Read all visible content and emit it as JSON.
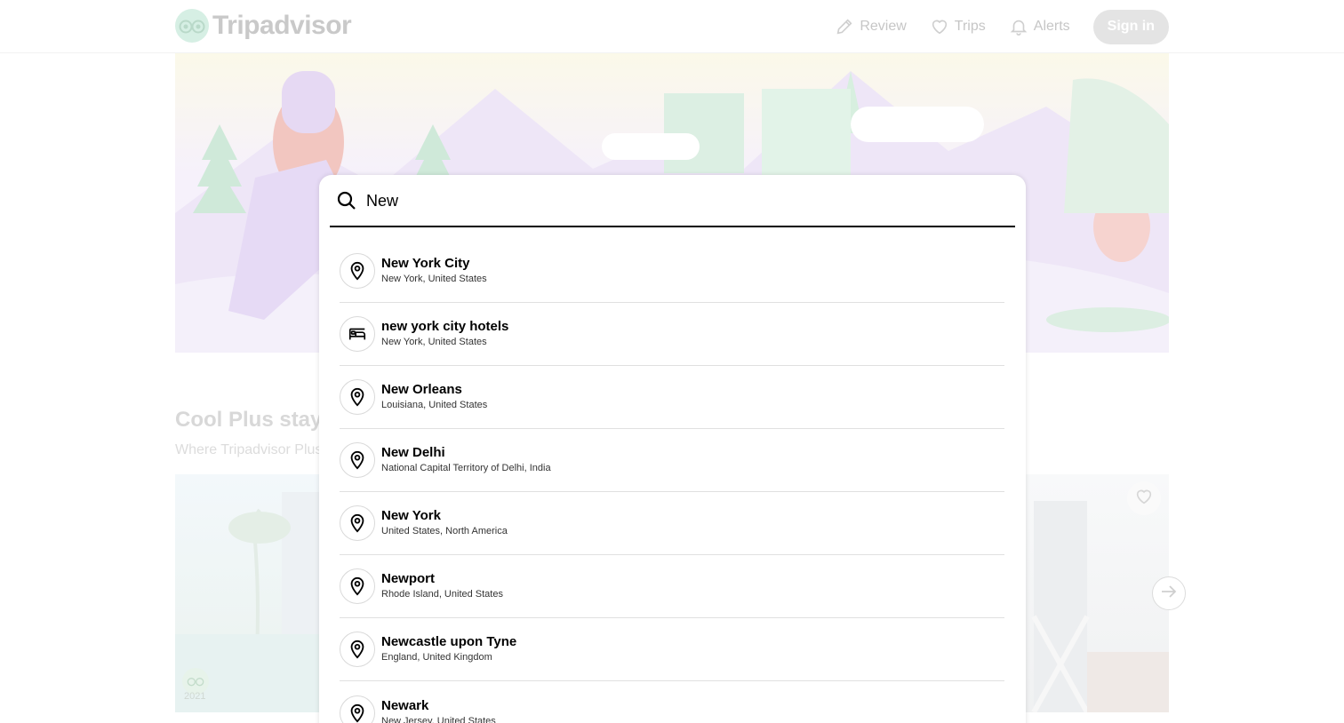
{
  "header": {
    "logo_text": "Tripadvisor",
    "nav": [
      {
        "label": "Review",
        "icon": "pencil-icon"
      },
      {
        "label": "Trips",
        "icon": "heart-icon"
      },
      {
        "label": "Alerts",
        "icon": "bell-icon"
      }
    ],
    "signin_label": "Sign in"
  },
  "section": {
    "title": "Cool Plus stays",
    "subtitle": "Where Tripadvisor Plus",
    "award_year": "2021"
  },
  "search": {
    "value": "New",
    "icon": "search-icon"
  },
  "results": [
    {
      "title": "New York City",
      "subtitle": "New York, United States",
      "icon": "map-pin-icon"
    },
    {
      "title": "new york city hotels",
      "subtitle": "New York, United States",
      "icon": "bed-icon"
    },
    {
      "title": "New Orleans",
      "subtitle": "Louisiana, United States",
      "icon": "map-pin-icon"
    },
    {
      "title": "New Delhi",
      "subtitle": "National Capital Territory of Delhi, India",
      "icon": "map-pin-icon"
    },
    {
      "title": "New York",
      "subtitle": "United States, North America",
      "icon": "map-pin-icon"
    },
    {
      "title": "Newport",
      "subtitle": "Rhode Island, United States",
      "icon": "map-pin-icon"
    },
    {
      "title": "Newcastle upon Tyne",
      "subtitle": "England, United Kingdom",
      "icon": "map-pin-icon"
    },
    {
      "title": "Newark",
      "subtitle": "New Jersey, United States",
      "icon": "map-pin-icon"
    }
  ],
  "colors": {
    "accent": "#000000",
    "brand_faded": "#d6efe4",
    "divider": "#e0e0e0"
  }
}
